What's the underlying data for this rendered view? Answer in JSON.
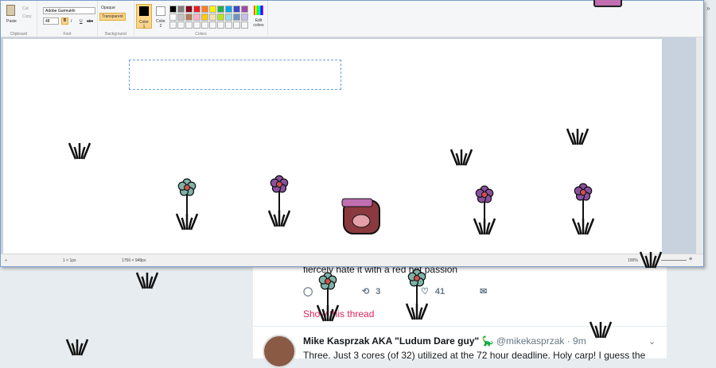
{
  "paint": {
    "clipboard": {
      "paste": "Paste",
      "cut": "Cut",
      "copy": "Copy",
      "label": "Clipboard"
    },
    "font": {
      "family": "Adobe Gurmukhi",
      "size": "48",
      "label": "Font",
      "bold": "B",
      "italic": "I",
      "underline": "U",
      "strike": "abc"
    },
    "background": {
      "opaque": "Opaque",
      "transparent": "Transparent",
      "label": "Background"
    },
    "colors": {
      "color1": "Color 1",
      "color2": "Color 2",
      "edit": "Edit colors",
      "label": "Colors",
      "palette_row1": [
        "#000000",
        "#7f7f7f",
        "#880015",
        "#ed1c24",
        "#ff7f27",
        "#fff200",
        "#22b14c",
        "#00a2e8",
        "#3f48cc",
        "#a349a4"
      ],
      "palette_row2": [
        "#ffffff",
        "#c3c3c3",
        "#b97a57",
        "#ffaec9",
        "#ffc90e",
        "#efe4b0",
        "#b5e61d",
        "#99d9ea",
        "#7092be",
        "#c8bfe7"
      ]
    },
    "status": {
      "cursor": "1 × 1px",
      "size": "1756 × 948px",
      "zoom": "100%"
    }
  },
  "tweet1": {
    "text": "fiercely hate it with a red hot passion",
    "replies": "",
    "retweets": "3",
    "likes": "41",
    "show_thread": "Show this thread"
  },
  "tweet2": {
    "name": "Mike Kasprzak AKA \"Ludum Dare guy\"",
    "emoji": "🦕",
    "handle": "@mikekasprzak · 9m",
    "text": "Three. Just 3 cores (of 32) utilized at the 72 hour deadline. Holy carp! I guess the"
  }
}
